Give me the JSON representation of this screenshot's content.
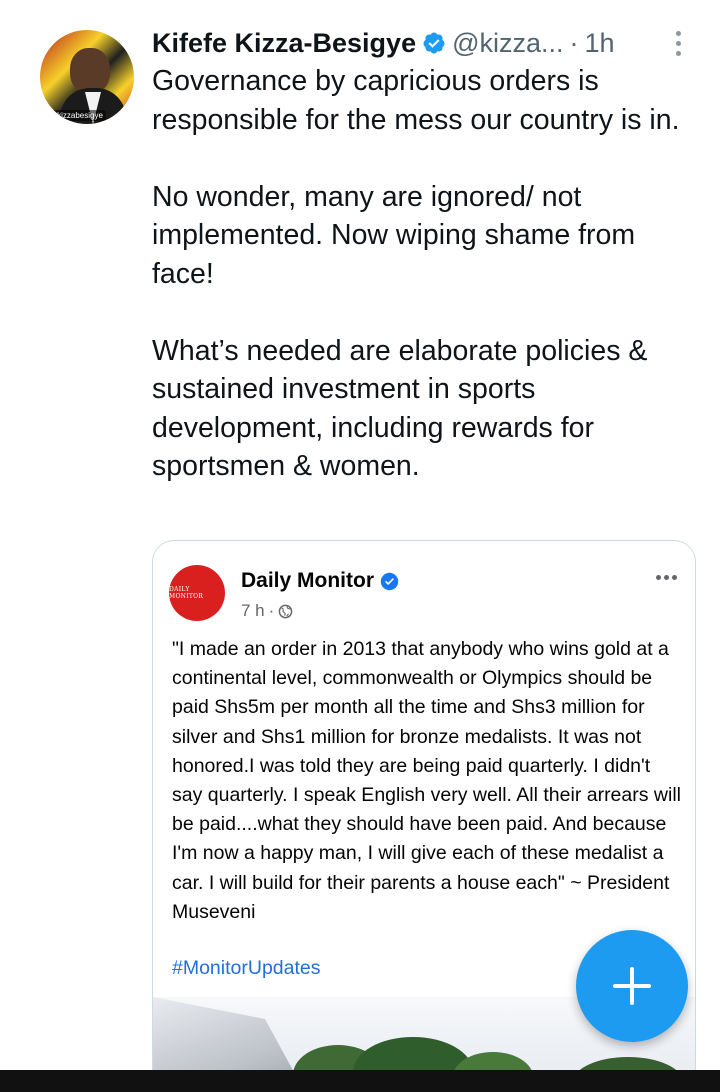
{
  "tweet": {
    "author_name": "Kifefe Kizza-Besigye",
    "author_handle": "@kizza...",
    "separator": "·",
    "time": "1h",
    "avatar_tag": "@kizzabesigye",
    "paragraphs": [
      "Governance by capricious orders is responsible for the mess our country is in.",
      "No wonder, many are ignored/ not implemented. Now wiping shame from face!",
      "What’s needed are elaborate policies & sustained investment in sports development, including rewards for sportsmen & women."
    ],
    "more_icon": "vertical-ellipsis-icon",
    "verified_icon": "verified-badge-icon"
  },
  "embedded_post": {
    "logo_text": "DAILY MONITOR",
    "page_name": "Daily Monitor",
    "time": "7 h",
    "separator": "·",
    "privacy_icon": "globe-icon",
    "more_icon": "horizontal-ellipsis-icon",
    "text": "\"I made an order in 2013 that anybody who wins gold at a continental level, commonwealth or Olympics should be paid Shs5m per month all the time and Shs3 million for silver and Shs1 million for bronze medalists. It was not honored.I was told they are being paid quarterly. I didn't say quarterly. I speak English very well. All their arrears will be paid....what they should have been paid. And because I'm now a happy man, I will give each of these medalist a car. I will build for their parents a house each\" ~ President Museveni",
    "hashtag": "#MonitorUpdates"
  },
  "compose_button": {
    "icon": "plus-icon"
  },
  "colors": {
    "accent": "#1d9bf0",
    "text_primary": "#0f1419",
    "text_secondary": "#536471",
    "facebook_link": "#216fdb",
    "monitor_red": "#d9201e"
  }
}
